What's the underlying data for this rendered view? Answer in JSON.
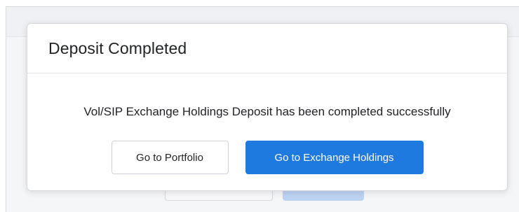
{
  "modal": {
    "title": "Deposit Completed",
    "message": "Vol/SIP Exchange Holdings Deposit has been completed successfully",
    "buttons": {
      "portfolio_label": "Go to Portfolio",
      "exchange_holdings_label": "Go to Exchange Holdings"
    }
  },
  "colors": {
    "primary_button": "#1f7ae0",
    "overlay_background": "#f5f6f8"
  }
}
